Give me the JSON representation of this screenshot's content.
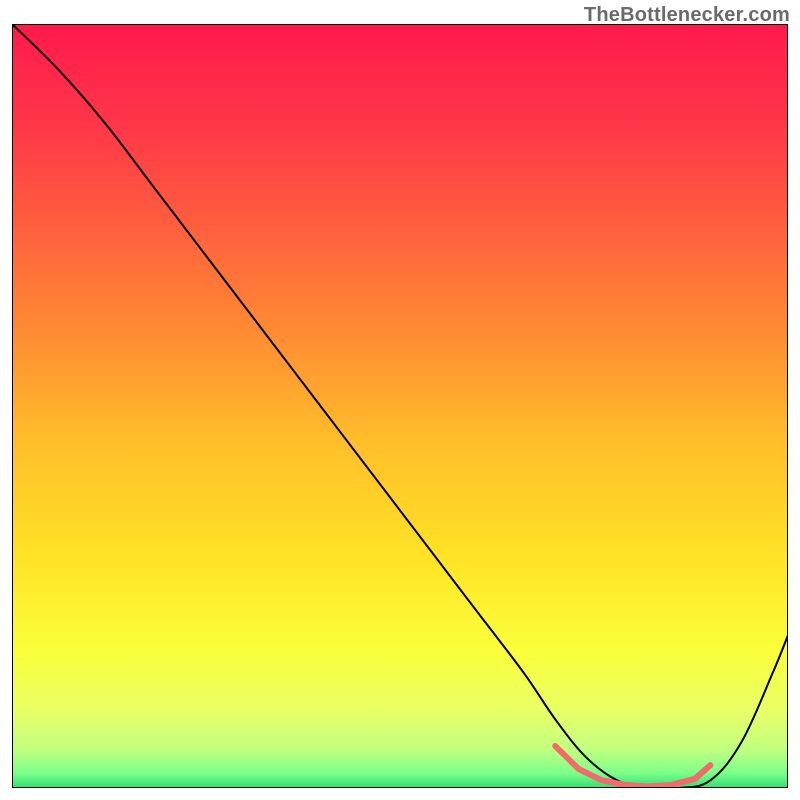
{
  "attribution": "TheBottlenecker.com",
  "chart_data": {
    "type": "line",
    "title": "",
    "xlabel": "",
    "ylabel": "",
    "xlim": [
      0,
      100
    ],
    "ylim": [
      0,
      100
    ],
    "background_gradient": {
      "stops": [
        {
          "offset": 0.0,
          "color": "#ff1a4d"
        },
        {
          "offset": 0.12,
          "color": "#ff3349"
        },
        {
          "offset": 0.25,
          "color": "#ff5a3f"
        },
        {
          "offset": 0.4,
          "color": "#ff8a33"
        },
        {
          "offset": 0.55,
          "color": "#ffbf2a"
        },
        {
          "offset": 0.7,
          "color": "#ffe326"
        },
        {
          "offset": 0.82,
          "color": "#faff3a"
        },
        {
          "offset": 0.9,
          "color": "#e8ff66"
        },
        {
          "offset": 0.95,
          "color": "#c0ff80"
        },
        {
          "offset": 0.98,
          "color": "#7dff8a"
        },
        {
          "offset": 1.0,
          "color": "#30e070"
        }
      ]
    },
    "series": [
      {
        "name": "bottleneck-curve",
        "stroke": "#000000",
        "stroke_width": 2,
        "x": [
          0,
          6,
          12,
          18,
          24,
          30,
          36,
          42,
          48,
          54,
          60,
          66,
          70,
          74,
          78,
          82,
          86,
          90,
          94,
          98,
          100
        ],
        "y": [
          100,
          94,
          87,
          79,
          71,
          63,
          55,
          47,
          39,
          31,
          23,
          15,
          9,
          4,
          1,
          0,
          0,
          1,
          6,
          15,
          20
        ]
      }
    ],
    "highlight_band": {
      "name": "optimal-range-band",
      "color": "#f26a6a",
      "stroke_width": 6,
      "x": [
        70,
        73,
        76,
        79,
        82,
        85,
        88,
        90
      ],
      "y": [
        5.5,
        2.5,
        1.0,
        0.4,
        0.2,
        0.4,
        1.2,
        3.0
      ]
    },
    "frame": {
      "stroke": "#000000",
      "stroke_width": 2
    }
  }
}
